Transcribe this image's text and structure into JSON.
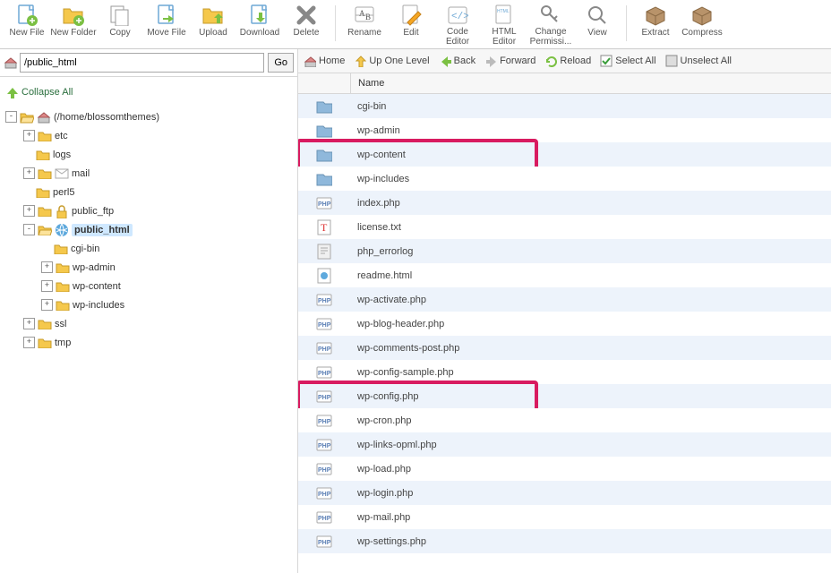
{
  "toolbar": {
    "new_file": "New File",
    "new_folder": "New Folder",
    "copy": "Copy",
    "move": "Move File",
    "upload": "Upload",
    "download": "Download",
    "delete": "Delete",
    "rename": "Rename",
    "edit": "Edit",
    "code_editor": "Code Editor",
    "html_editor": "HTML Editor",
    "change_perm": "Change Permissi...",
    "view": "View",
    "extract": "Extract",
    "compress": "Compress"
  },
  "path_input": "/public_html",
  "go_label": "Go",
  "collapse_all": "Collapse All",
  "tree_root_label": "(/home/blossomthemes)",
  "tree": {
    "etc": "etc",
    "logs": "logs",
    "mail": "mail",
    "perl5": "perl5",
    "public_ftp": "public_ftp",
    "public_html": "public_html",
    "cgi_bin": "cgi-bin",
    "wp_admin": "wp-admin",
    "wp_content": "wp-content",
    "wp_includes": "wp-includes",
    "ssl": "ssl",
    "tmp": "tmp"
  },
  "navbar": {
    "home": "Home",
    "up": "Up One Level",
    "back": "Back",
    "forward": "Forward",
    "reload": "Reload",
    "select_all": "Select All",
    "unselect_all": "Unselect All"
  },
  "list_header": "Name",
  "files": [
    {
      "name": "cgi-bin",
      "type": "folder"
    },
    {
      "name": "wp-admin",
      "type": "folder"
    },
    {
      "name": "wp-content",
      "type": "folder",
      "hl": true
    },
    {
      "name": "wp-includes",
      "type": "folder"
    },
    {
      "name": "index.php",
      "type": "php"
    },
    {
      "name": "license.txt",
      "type": "txt"
    },
    {
      "name": "php_errorlog",
      "type": "log"
    },
    {
      "name": "readme.html",
      "type": "html"
    },
    {
      "name": "wp-activate.php",
      "type": "php"
    },
    {
      "name": "wp-blog-header.php",
      "type": "php"
    },
    {
      "name": "wp-comments-post.php",
      "type": "php"
    },
    {
      "name": "wp-config-sample.php",
      "type": "php"
    },
    {
      "name": "wp-config.php",
      "type": "php",
      "hl": true
    },
    {
      "name": "wp-cron.php",
      "type": "php"
    },
    {
      "name": "wp-links-opml.php",
      "type": "php"
    },
    {
      "name": "wp-load.php",
      "type": "php"
    },
    {
      "name": "wp-login.php",
      "type": "php"
    },
    {
      "name": "wp-mail.php",
      "type": "php"
    },
    {
      "name": "wp-settings.php",
      "type": "php"
    }
  ]
}
